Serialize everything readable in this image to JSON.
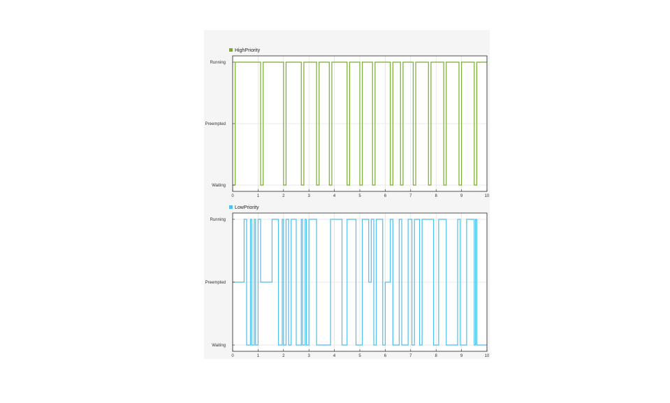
{
  "chart_data": [
    {
      "type": "line",
      "step": "post",
      "series": [
        {
          "name": "HighPriority",
          "color": "#77ac30",
          "x": [
            0,
            0.1,
            1.1,
            1.2,
            2.0,
            2.1,
            2.7,
            2.8,
            3.3,
            3.4,
            3.8,
            3.9,
            4.5,
            4.6,
            5.0,
            5.1,
            5.5,
            5.6,
            6.2,
            6.3,
            6.6,
            6.7,
            7.1,
            7.2,
            7.7,
            7.8,
            8.3,
            8.4,
            8.9,
            9.0,
            9.5,
            9.6,
            10.0
          ],
          "y": [
            "Waiting",
            "Running",
            "Waiting",
            "Running",
            "Waiting",
            "Running",
            "Waiting",
            "Running",
            "Waiting",
            "Running",
            "Waiting",
            "Running",
            "Waiting",
            "Running",
            "Waiting",
            "Running",
            "Waiting",
            "Running",
            "Waiting",
            "Running",
            "Waiting",
            "Running",
            "Waiting",
            "Running",
            "Waiting",
            "Running",
            "Waiting",
            "Running",
            "Waiting",
            "Running",
            "Waiting",
            "Running",
            "Running"
          ]
        }
      ],
      "xlim": [
        0,
        10
      ],
      "x_ticks": [
        "0",
        "1",
        "2",
        "3",
        "4",
        "5",
        "6",
        "7",
        "8",
        "9",
        "10"
      ],
      "y_levels": [
        "Waiting",
        "Preempted",
        "Running"
      ],
      "grid": true,
      "legend_position": "top-left"
    },
    {
      "type": "line",
      "step": "post",
      "series": [
        {
          "name": "LowPriority",
          "color": "#4dbeee",
          "x": [
            0,
            0.45,
            0.55,
            0.7,
            0.75,
            0.85,
            0.9,
            1.0,
            1.1,
            1.55,
            1.8,
            1.95,
            2.0,
            2.1,
            2.2,
            2.3,
            2.5,
            2.7,
            2.75,
            2.85,
            2.9,
            3.0,
            3.3,
            3.85,
            4.3,
            4.5,
            4.85,
            5.1,
            5.35,
            5.45,
            5.55,
            5.65,
            5.9,
            6.0,
            6.2,
            6.3,
            6.55,
            6.65,
            6.9,
            7.05,
            7.15,
            7.35,
            7.45,
            7.9,
            8.1,
            8.4,
            8.85,
            8.95,
            9.2,
            9.5,
            9.55,
            9.6,
            9.7,
            10.0
          ],
          "y": [
            "Preempted",
            "Running",
            "Waiting",
            "Running",
            "Waiting",
            "Running",
            "Waiting",
            "Running",
            "Preempted",
            "Running",
            "Waiting",
            "Running",
            "Waiting",
            "Running",
            "Waiting",
            "Running",
            "Waiting",
            "Running",
            "Waiting",
            "Running",
            "Waiting",
            "Running",
            "Waiting",
            "Running",
            "Waiting",
            "Running",
            "Waiting",
            "Running",
            "Preempted",
            "Running",
            "Waiting",
            "Running",
            "Waiting",
            "Preempted",
            "Running",
            "Waiting",
            "Running",
            "Waiting",
            "Running",
            "Waiting",
            "Running",
            "Waiting",
            "Running",
            "Waiting",
            "Running",
            "Waiting",
            "Running",
            "Waiting",
            "Running",
            "Waiting",
            "Running",
            "Waiting",
            "Waiting",
            "Waiting"
          ]
        }
      ],
      "xlim": [
        0,
        10
      ],
      "x_ticks": [
        "0",
        "1",
        "2",
        "3",
        "4",
        "5",
        "6",
        "7",
        "8",
        "9",
        "10"
      ],
      "y_levels": [
        "Waiting",
        "Preempted",
        "Running"
      ],
      "grid": true,
      "legend_position": "top-left"
    }
  ]
}
